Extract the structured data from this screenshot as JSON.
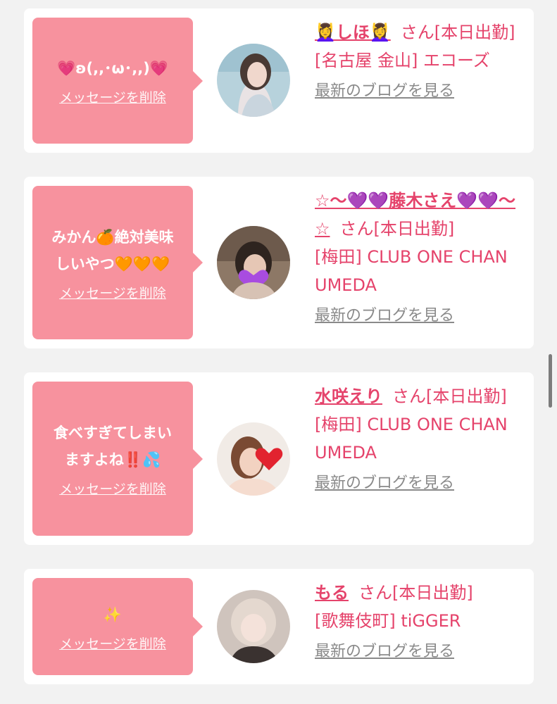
{
  "cards": [
    {
      "message": "💗ʚ(,,･ω･,,)💗",
      "delete_label": "メッセージを削除",
      "name": "💆‍♀️しほ💆‍♀️",
      "suffix": "さん[本日出勤]",
      "shop": "[名古屋 金山] エコーズ",
      "blog_label": "最新のブログを見る"
    },
    {
      "message": "みかん🍊絶対美味\nしいやつ🧡🧡🧡",
      "delete_label": "メッセージを削除",
      "name": "☆〜💜💜藤木さえ💜💜〜☆",
      "suffix": "さん[本日出勤]",
      "shop": "[梅田] CLUB ONE CHAN UMEDA",
      "blog_label": "最新のブログを見る"
    },
    {
      "message": "食べすぎてしまい\nますよね‼️💦",
      "delete_label": "メッセージを削除",
      "name": "水咲えり",
      "suffix": "さん[本日出勤]",
      "shop": "[梅田] CLUB ONE CHAN UMEDA",
      "blog_label": "最新のブログを見る"
    },
    {
      "message": "✨",
      "delete_label": "メッセージを削除",
      "name": "もる",
      "suffix": "さん[本日出勤]",
      "shop": "[歌舞伎町] tiGGER",
      "blog_label": "最新のブログを見る"
    }
  ],
  "colors": {
    "bubble": "#f7929e",
    "accent": "#e5436b",
    "link_gray": "#8a8a8a",
    "background": "#f2f2f2"
  }
}
